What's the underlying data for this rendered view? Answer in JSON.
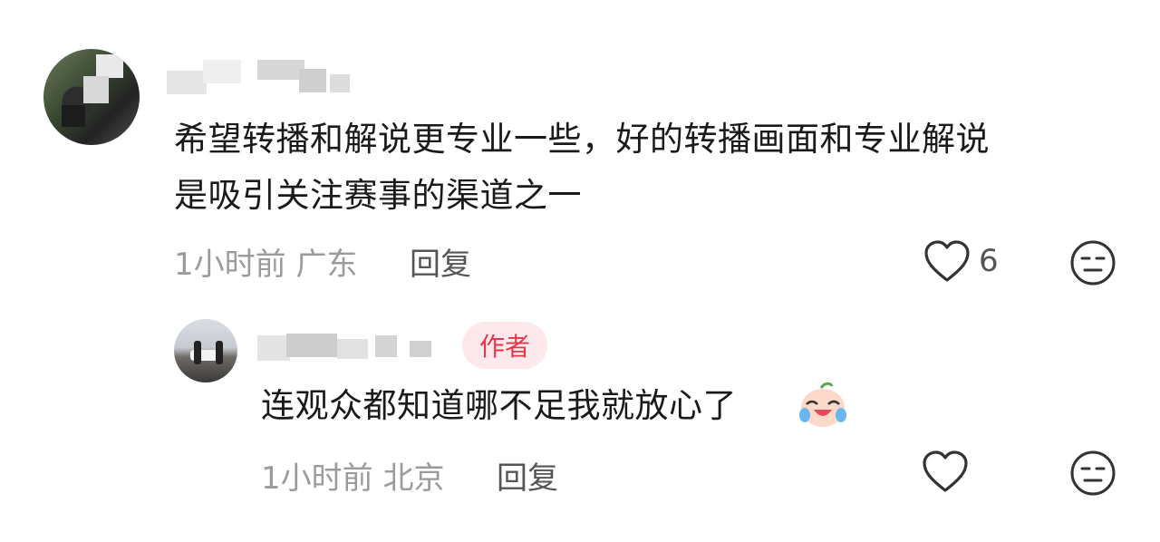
{
  "comments": [
    {
      "text_line1": "希望转播和解说更专业一些，好的转播画面和专业解说",
      "text_line2": "是吸引关注赛事的渠道之一",
      "time_location": "1小时前 广东",
      "reply_label": "回复",
      "like_count": "6",
      "avatar_icon": "user-avatar",
      "like_icon": "heart-outline-icon",
      "dislike_icon": "neutral-face-icon"
    }
  ],
  "reply": {
    "badge": "作者",
    "text": "连观众都知道哪不足我就放心了",
    "emoji_icon": "crying-laughing-emoji-icon",
    "time_location": "1小时前 北京",
    "reply_label": "回复",
    "like_icon": "heart-outline-icon",
    "dislike_icon": "neutral-face-icon"
  },
  "colors": {
    "badge_bg": "#fde9ec",
    "badge_text": "#e5374a",
    "meta_text": "#9b9b9b"
  }
}
